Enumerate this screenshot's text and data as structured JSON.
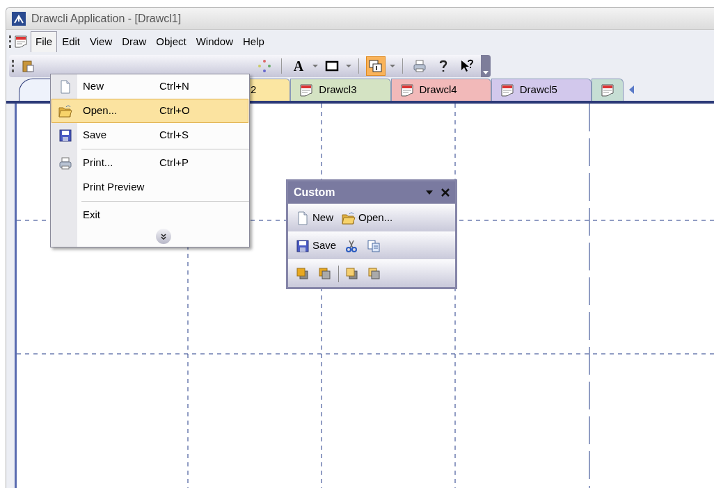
{
  "window": {
    "title": "Drawcli Application - [Drawcl1]"
  },
  "menu_bar": [
    {
      "label": "File",
      "selected": true
    },
    {
      "label": "Edit",
      "selected": false
    },
    {
      "label": "View",
      "selected": false
    },
    {
      "label": "Draw",
      "selected": false
    },
    {
      "label": "Object",
      "selected": false
    },
    {
      "label": "Window",
      "selected": false
    },
    {
      "label": "Help",
      "selected": false
    }
  ],
  "toolbar": [
    {
      "kind": "paste"
    },
    {
      "kind": "circles"
    },
    {
      "kind": "separator"
    },
    {
      "kind": "font",
      "glyph": "A"
    },
    {
      "kind": "caret"
    },
    {
      "kind": "rectangle"
    },
    {
      "kind": "caret"
    },
    {
      "kind": "separator"
    },
    {
      "kind": "window",
      "checked": true
    },
    {
      "kind": "caret"
    },
    {
      "kind": "separator"
    },
    {
      "kind": "printer"
    },
    {
      "kind": "help"
    },
    {
      "kind": "pointer-help"
    }
  ],
  "tabs": [
    {
      "color": "#eef2fb",
      "selected": true
    },
    {
      "label": "2",
      "color": "#fbe6a2",
      "selected": false
    },
    {
      "label": "Drawcl3",
      "color": "#d4e3c3",
      "selected": false
    },
    {
      "label": "Drawcl4",
      "color": "#f2b9b9",
      "selected": false
    },
    {
      "label": "Drawcl5",
      "color": "#d2c8ec",
      "selected": false
    },
    {
      "color": "#c6ded4",
      "selected": false
    }
  ],
  "file_menu": {
    "items": [
      {
        "kind": "new",
        "label": "New",
        "shortcut": "Ctrl+N",
        "selected": false,
        "divider_above": false
      },
      {
        "kind": "open",
        "label": "Open...",
        "shortcut": "Ctrl+O",
        "selected": true,
        "divider_above": false
      },
      {
        "kind": "save",
        "label": "Save",
        "shortcut": "Ctrl+S",
        "selected": false,
        "divider_above": false
      },
      {
        "kind": "print",
        "label": "Print...",
        "shortcut": "Ctrl+P",
        "selected": false,
        "divider_above": true
      },
      {
        "kind": "plain",
        "label": "Print Preview",
        "selected": false,
        "divider_above": false
      },
      {
        "kind": "plain",
        "label": "Exit",
        "selected": false,
        "divider_above": true
      }
    ]
  },
  "custom_toolbar": {
    "title": "Custom",
    "rows": [
      [
        {
          "kind": "new",
          "label": "New"
        },
        {
          "kind": "open",
          "label": "Open..."
        }
      ],
      [
        {
          "kind": "save",
          "label": "Save"
        },
        {
          "kind": "cut"
        },
        {
          "kind": "copy"
        }
      ],
      [
        {
          "kind": "front"
        },
        {
          "kind": "back"
        },
        {
          "kind": "separator"
        },
        {
          "kind": "forward"
        },
        {
          "kind": "backward"
        }
      ]
    ]
  }
}
